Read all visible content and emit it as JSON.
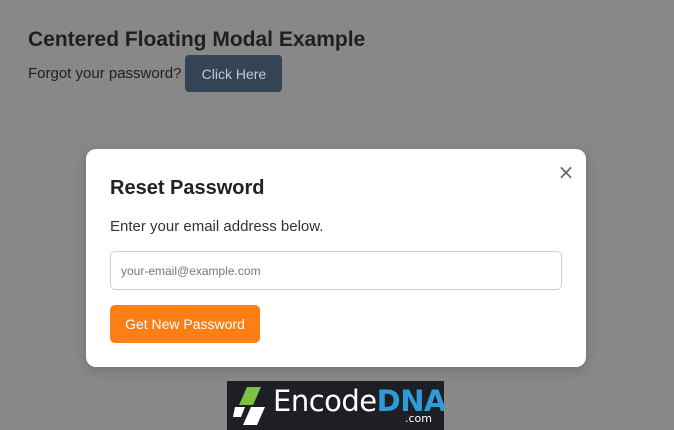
{
  "page": {
    "title": "Centered Floating Modal Example",
    "forgot_text": "Forgot your password?",
    "open_button_label": "Click Here"
  },
  "modal": {
    "title": "Reset Password",
    "description": "Enter your email address below.",
    "email_placeholder": "your-email@example.com",
    "email_value": "",
    "submit_label": "Get New Password",
    "close_glyph": "×",
    "close_icon": "close-icon"
  },
  "logo": {
    "word_main": "Encode",
    "word_accent": "DNA",
    "suffix": ".com",
    "icon": "encodedna-logo-mark"
  },
  "colors": {
    "overlay_background": "#888888",
    "open_button_bg": "#344355",
    "submit_button_bg": "#fd7e14",
    "logo_accent": "#2f9bd8",
    "logo_green": "#7bc142"
  }
}
